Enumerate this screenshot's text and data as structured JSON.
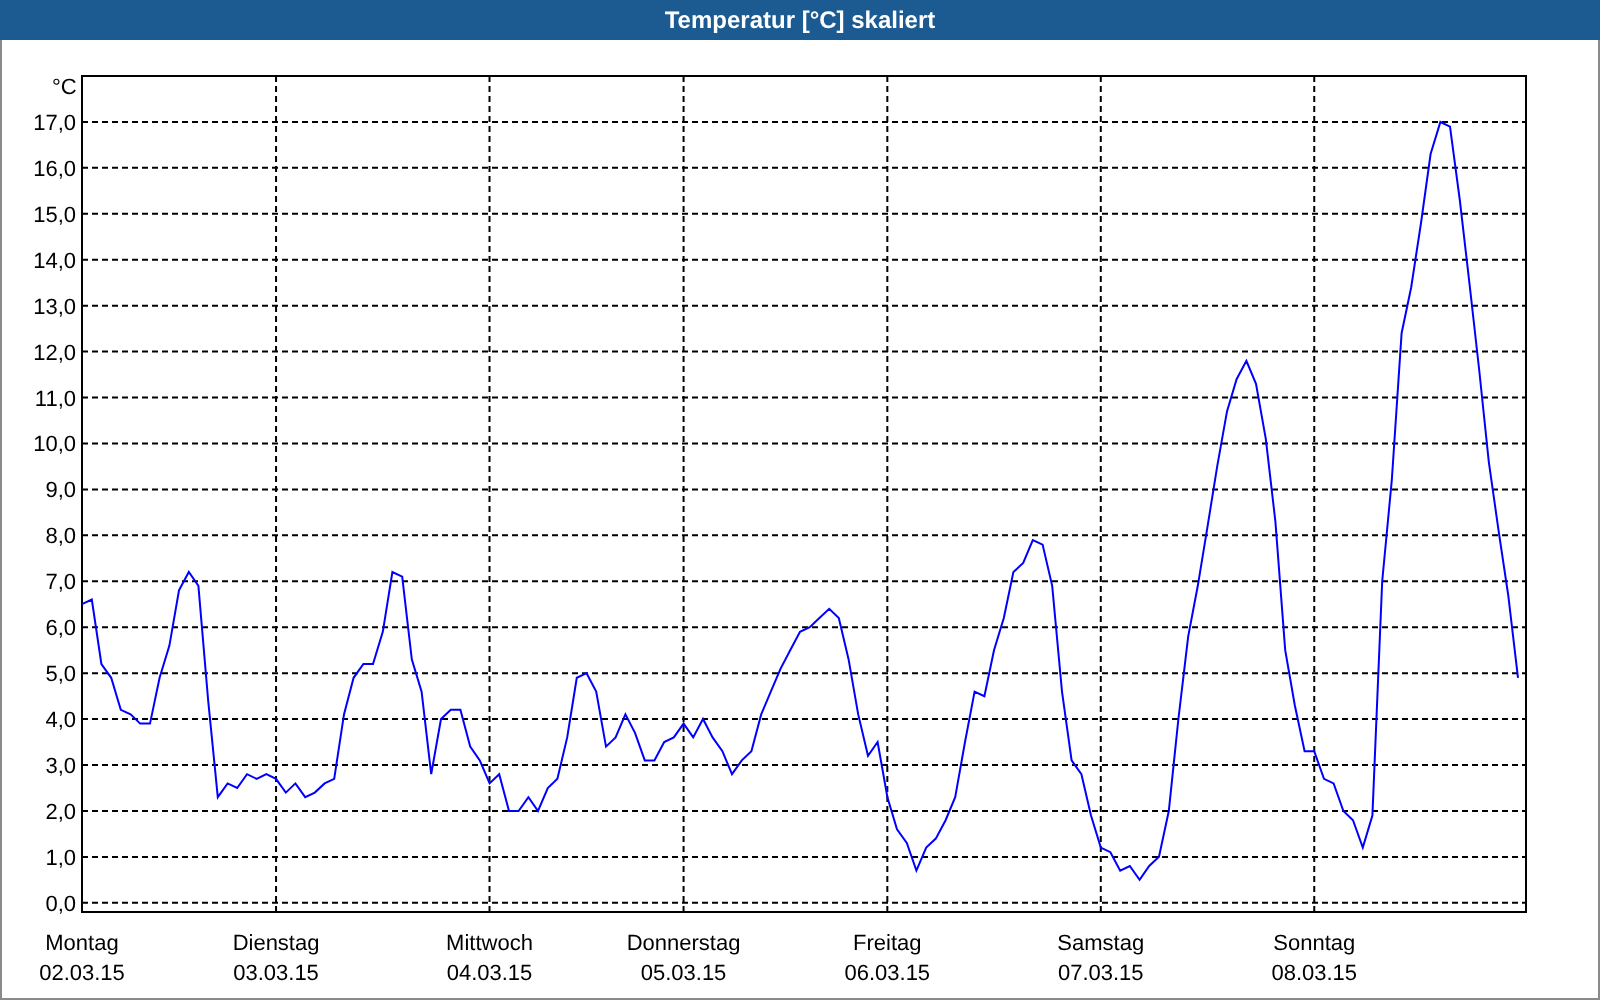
{
  "window": {
    "title": "Temperatur [°C] skaliert"
  },
  "chart": {
    "chart_data": {
      "type": "line",
      "grid": true,
      "ylabel": "°C",
      "ylim": [
        -0.2,
        18
      ],
      "yticks": [
        {
          "value": 0,
          "label": "0,0"
        },
        {
          "value": 1,
          "label": "1,0"
        },
        {
          "value": 2,
          "label": "2,0"
        },
        {
          "value": 3,
          "label": "3,0"
        },
        {
          "value": 4,
          "label": "4,0"
        },
        {
          "value": 5,
          "label": "5,0"
        },
        {
          "value": 6,
          "label": "6,0"
        },
        {
          "value": 7,
          "label": "7,0"
        },
        {
          "value": 8,
          "label": "8,0"
        },
        {
          "value": 9,
          "label": "9,0"
        },
        {
          "value": 10,
          "label": "10,0"
        },
        {
          "value": 11,
          "label": "11,0"
        },
        {
          "value": 12,
          "label": "12,0"
        },
        {
          "value": 13,
          "label": "13,0"
        },
        {
          "value": 14,
          "label": "14,0"
        },
        {
          "value": 15,
          "label": "15,0"
        },
        {
          "value": 16,
          "label": "16,0"
        },
        {
          "value": 17,
          "label": "17,0"
        }
      ],
      "categories": [
        "Montag\n02.03.15",
        null,
        null,
        null,
        null,
        null,
        null,
        null,
        null,
        null,
        null,
        null,
        null,
        null,
        null,
        null,
        null,
        null,
        null,
        null,
        "Dienstag\n03.03.15",
        null,
        null,
        null,
        null,
        null,
        null,
        null,
        null,
        null,
        null,
        null,
        null,
        null,
        null,
        null,
        null,
        null,
        null,
        null,
        null,
        null,
        "Mittwoch\n04.03.15",
        null,
        null,
        null,
        null,
        null,
        null,
        null,
        null,
        null,
        null,
        null,
        null,
        null,
        null,
        null,
        null,
        null,
        null,
        null,
        "Donnerstag\n05.03.15",
        null,
        null,
        null,
        null,
        null,
        null,
        null,
        null,
        null,
        null,
        null,
        null,
        null,
        null,
        null,
        null,
        null,
        null,
        null,
        null,
        "Freitag\n06.03.15",
        null,
        null,
        null,
        null,
        null,
        null,
        null,
        null,
        null,
        null,
        null,
        null,
        null,
        null,
        null,
        null,
        null,
        null,
        null,
        null,
        null,
        "Samstag\n07.03.15",
        null,
        null,
        null,
        null,
        null,
        null,
        null,
        null,
        null,
        null,
        null,
        null,
        null,
        null,
        null,
        null,
        null,
        null,
        null,
        null,
        null,
        "Sonntag\n08.03.15",
        null,
        null,
        null,
        null,
        null,
        null,
        null,
        null,
        null,
        null,
        null,
        null,
        null,
        null,
        null,
        null,
        null,
        null,
        null,
        null,
        null
      ],
      "series": [
        {
          "color": "#0000ff",
          "values": [
            6.5,
            6.6,
            5.2,
            4.9,
            4.2,
            4.1,
            3.9,
            3.9,
            4.9,
            5.6,
            6.8,
            7.2,
            6.9,
            4.4,
            2.3,
            2.6,
            2.5,
            2.8,
            2.7,
            2.8,
            2.7,
            2.4,
            2.6,
            2.3,
            2.4,
            2.6,
            2.7,
            4.1,
            4.9,
            5.2,
            5.2,
            5.9,
            7.2,
            7.1,
            5.3,
            4.6,
            2.8,
            4.0,
            4.2,
            4.2,
            3.4,
            3.1,
            2.6,
            2.8,
            2.0,
            2.0,
            2.3,
            2.0,
            2.5,
            2.7,
            3.6,
            4.9,
            5.0,
            4.6,
            3.4,
            3.6,
            4.1,
            3.7,
            3.1,
            3.1,
            3.5,
            3.6,
            3.9,
            3.6,
            4.0,
            3.6,
            3.3,
            2.8,
            3.1,
            3.3,
            4.1,
            4.6,
            5.1,
            5.5,
            5.9,
            6.0,
            6.2,
            6.4,
            6.2,
            5.3,
            4.1,
            3.2,
            3.5,
            2.3,
            1.6,
            1.3,
            0.7,
            1.2,
            1.4,
            1.8,
            2.3,
            3.5,
            4.6,
            4.5,
            5.5,
            6.2,
            7.2,
            7.4,
            7.9,
            7.8,
            6.9,
            4.6,
            3.1,
            2.8,
            1.9,
            1.2,
            1.1,
            0.7,
            0.8,
            0.5,
            0.8,
            1.0,
            2.0,
            4.0,
            5.8,
            6.9,
            8.2,
            9.5,
            10.7,
            11.4,
            11.8,
            11.3,
            10.1,
            8.3,
            5.5,
            4.3,
            3.3,
            3.3,
            2.7,
            2.6,
            2.0,
            1.8,
            1.2,
            1.9,
            7.0,
            9.2,
            12.4,
            13.4,
            14.8,
            16.3,
            17.0,
            16.9,
            15.3,
            13.5,
            11.6,
            9.6,
            8.1,
            6.7,
            4.9
          ]
        }
      ]
    }
  }
}
